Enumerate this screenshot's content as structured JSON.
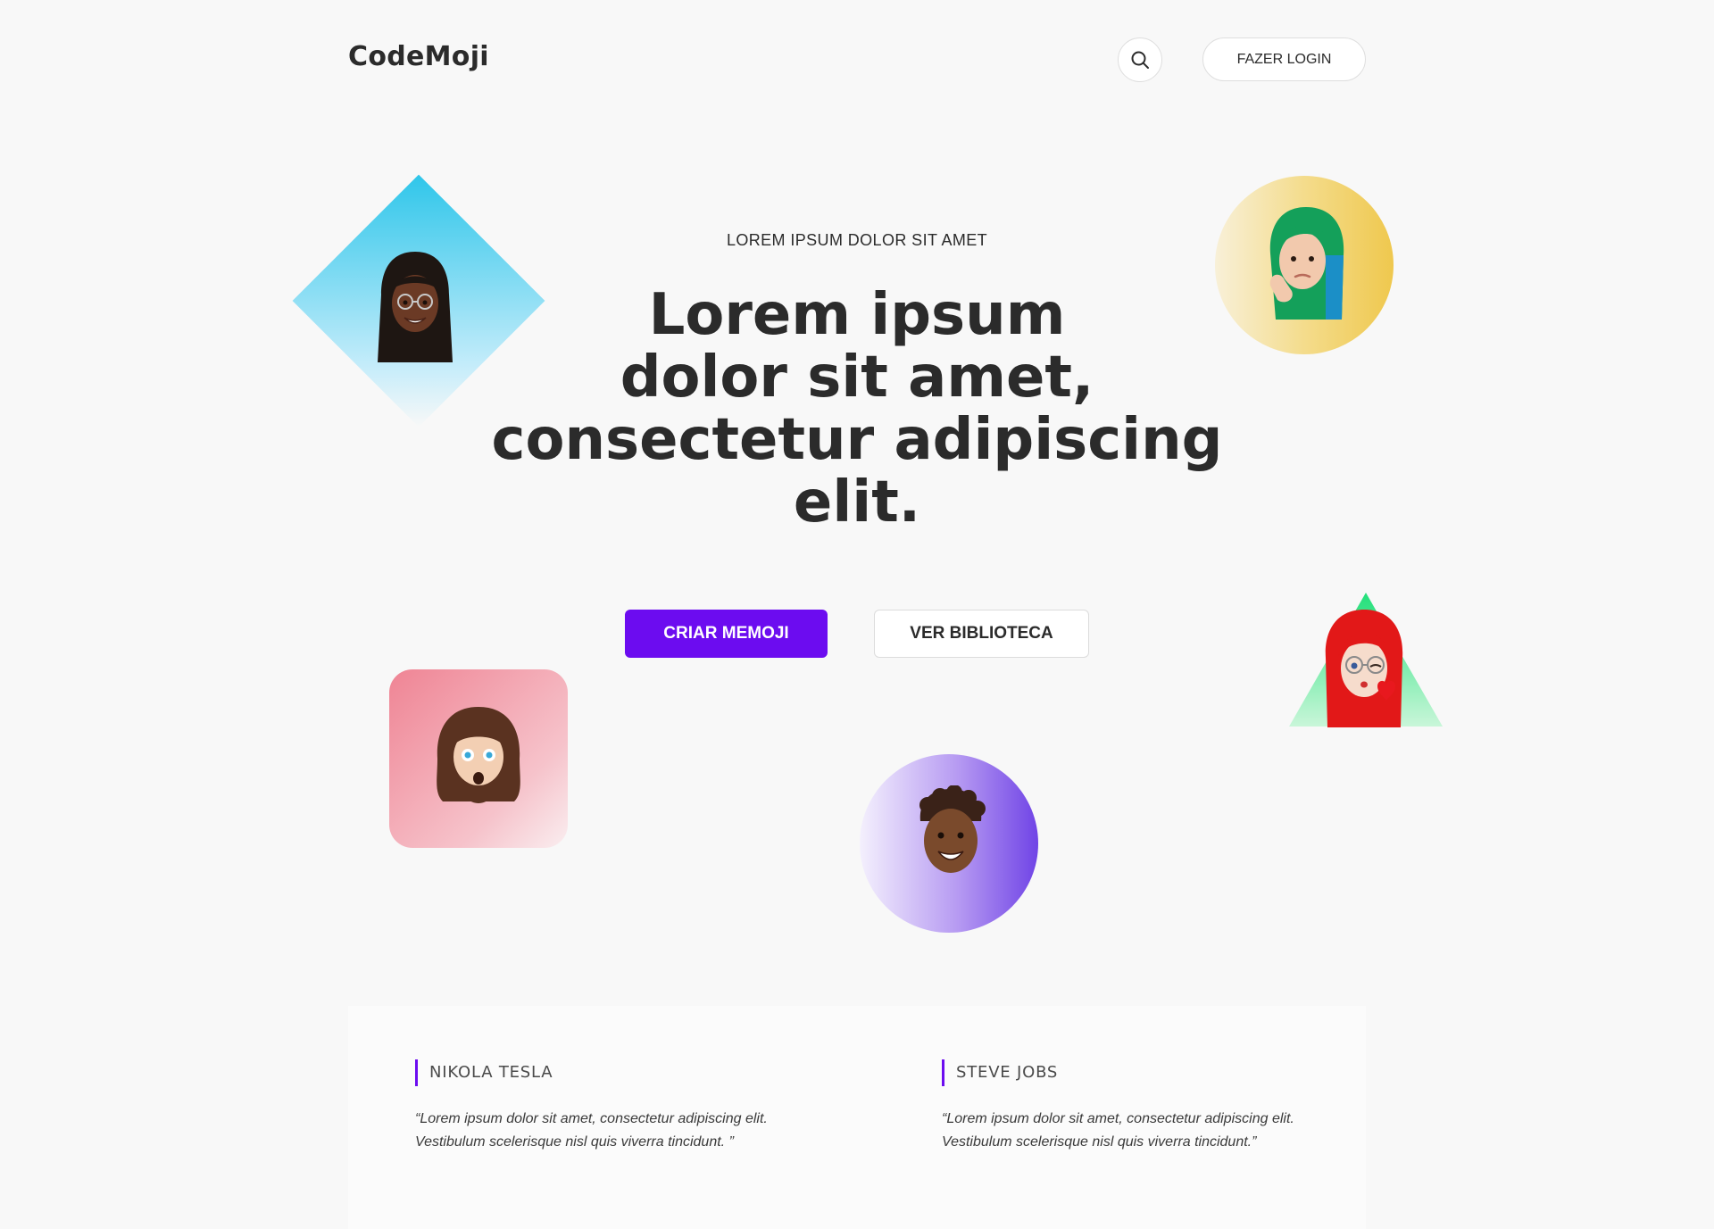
{
  "header": {
    "logo": "CodeMoji",
    "search_icon": "search-icon",
    "login_label": "FAZER LOGIN"
  },
  "hero": {
    "eyebrow": "LOREM IPSUM DOLOR SIT AMET",
    "title_line1": "Lorem ipsum",
    "title_line2": "dolor sit amet,",
    "title_line3": "consectetur adipiscing",
    "title_line4": "elit.",
    "primary_cta": "CRIAR MEMOJI",
    "secondary_cta": "VER BIBLIOTECA"
  },
  "avatars": [
    {
      "name": "avatar-long-black-hair-glasses",
      "shape": "diamond",
      "color": "#2fc6ea"
    },
    {
      "name": "avatar-green-hair-thinking",
      "shape": "circle",
      "color": "#efc84e"
    },
    {
      "name": "avatar-red-hair-kiss",
      "shape": "triangle",
      "color": "#22e07a"
    },
    {
      "name": "avatar-long-brown-hair-beard",
      "shape": "rounded-square",
      "color": "#ef8494"
    },
    {
      "name": "avatar-curly-hair-smile",
      "shape": "circle",
      "color": "#7044e6"
    }
  ],
  "testimonials": [
    {
      "name": "NIKOLA TESLA",
      "quote": "“Lorem ipsum dolor sit amet, consectetur adipiscing elit. Vestibulum scelerisque nisl quis viverra tincidunt. ”"
    },
    {
      "name": "STEVE JOBS",
      "quote": "“Lorem ipsum dolor sit amet, consectetur adipiscing elit. Vestibulum scelerisque nisl quis viverra tincidunt.”"
    }
  ],
  "colors": {
    "accent": "#6c0cf0",
    "background": "#f8f8f8",
    "text": "#2b2b2b"
  }
}
